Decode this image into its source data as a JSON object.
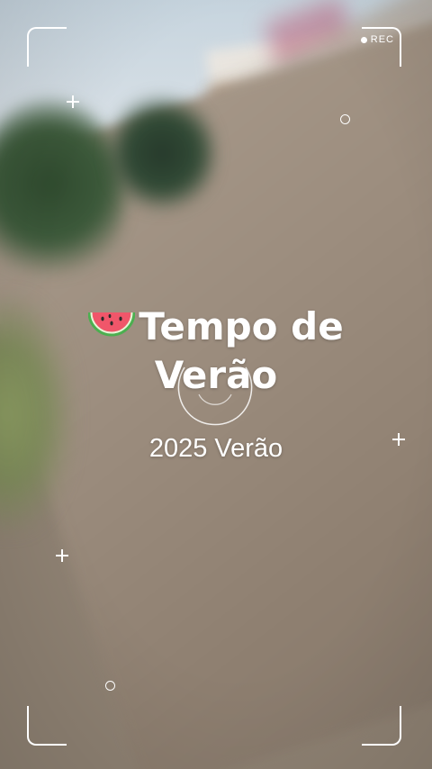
{
  "overlay": {
    "rec_label": "REC",
    "title_line1": "Tempo de",
    "title_line2": "Verão",
    "subtitle": "2025 Verão",
    "title_icon": "watermelon-icon"
  },
  "colors": {
    "overlay": "#ffffff",
    "watermelon_flesh": "#f0566a",
    "watermelon_rind": "#4caf50"
  }
}
